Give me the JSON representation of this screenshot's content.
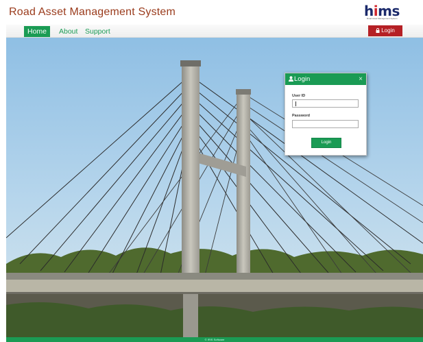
{
  "header": {
    "app_title": "Road Asset Management System",
    "logo": {
      "text_h": "h",
      "text_i": "i",
      "text_ms": "ms",
      "subtitle": "Road Asset Management System"
    }
  },
  "nav": {
    "items": [
      {
        "label": "Home",
        "active": true
      },
      {
        "label": "About",
        "active": false
      },
      {
        "label": "Support",
        "active": false
      }
    ],
    "login_label": "Login"
  },
  "login_modal": {
    "title": "Login",
    "close_glyph": "×",
    "user_id_label": "User ID",
    "user_id_value": "",
    "password_label": "Password",
    "password_value": "",
    "submit_label": "Login"
  },
  "footer": {
    "text": "© IRIS Software"
  },
  "colors": {
    "brand_green": "#1a9b54",
    "login_red": "#b52025",
    "title_brown": "#9a3b1c",
    "logo_navy": "#1b2a6b"
  },
  "icons": {
    "login_top": "lock-icon",
    "modal_title": "user-icon",
    "modal_close": "close-icon"
  }
}
